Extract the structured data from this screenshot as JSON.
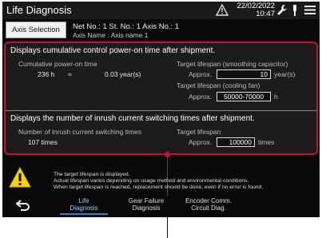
{
  "header": {
    "title": "Life Diagnosis",
    "date": "22/02/2022",
    "time": "10:47",
    "icons": [
      "warning-icon",
      "wrench-icon",
      "tool-icon",
      "menu-icon"
    ]
  },
  "axis": {
    "button_label": "Axis Selection",
    "net_no": "Net No.:  1   St. No.:  1   Axis No.:  1",
    "axis_name": "Axis Name : Axis name 1"
  },
  "power_on": {
    "title": "Displays cumulative control power-on time after shipment.",
    "cum_label": "Cumulative power-on time",
    "cum_hours": "236 h",
    "approx_symbol": "≈",
    "cum_years": "0.03 year(s)",
    "cap_label": "Target lifespan (smoothing capacitor)",
    "cap_approx": "Approx.",
    "cap_value": "10",
    "cap_unit": "year(s)",
    "fan_label": "Target lifespan (cooling fan)",
    "fan_approx": "Approx.",
    "fan_value": "50000-70000",
    "fan_unit": "h"
  },
  "inrush": {
    "title": "Displays the number of inrush current switching times after shipment.",
    "count_label": "Number of inrush current switching times",
    "count_value": "107 times",
    "target_label": "Target lifespan",
    "target_approx": "Approx.",
    "target_value": "100000",
    "target_unit": "times"
  },
  "message": {
    "line1": "The target lifespan is displayed.",
    "line2": "Actual lifespan varies depending on usage method and environmental conditions.",
    "line3": "When target lifespan is reached, replacement should be done, even if no error is found."
  },
  "nav": {
    "back_icon": "back-arrow-icon",
    "tabs": [
      {
        "line1": "Life",
        "line2": "Diagnosis"
      },
      {
        "line1": "Gear Failure",
        "line2": "Diagnosis"
      },
      {
        "line1": "Encoder Comm.",
        "line2": "Circuit Diag."
      }
    ]
  },
  "colors": {
    "highlight": "#c0143c",
    "active_tab": "#7fd0ff",
    "background": "#0a0a0a"
  }
}
